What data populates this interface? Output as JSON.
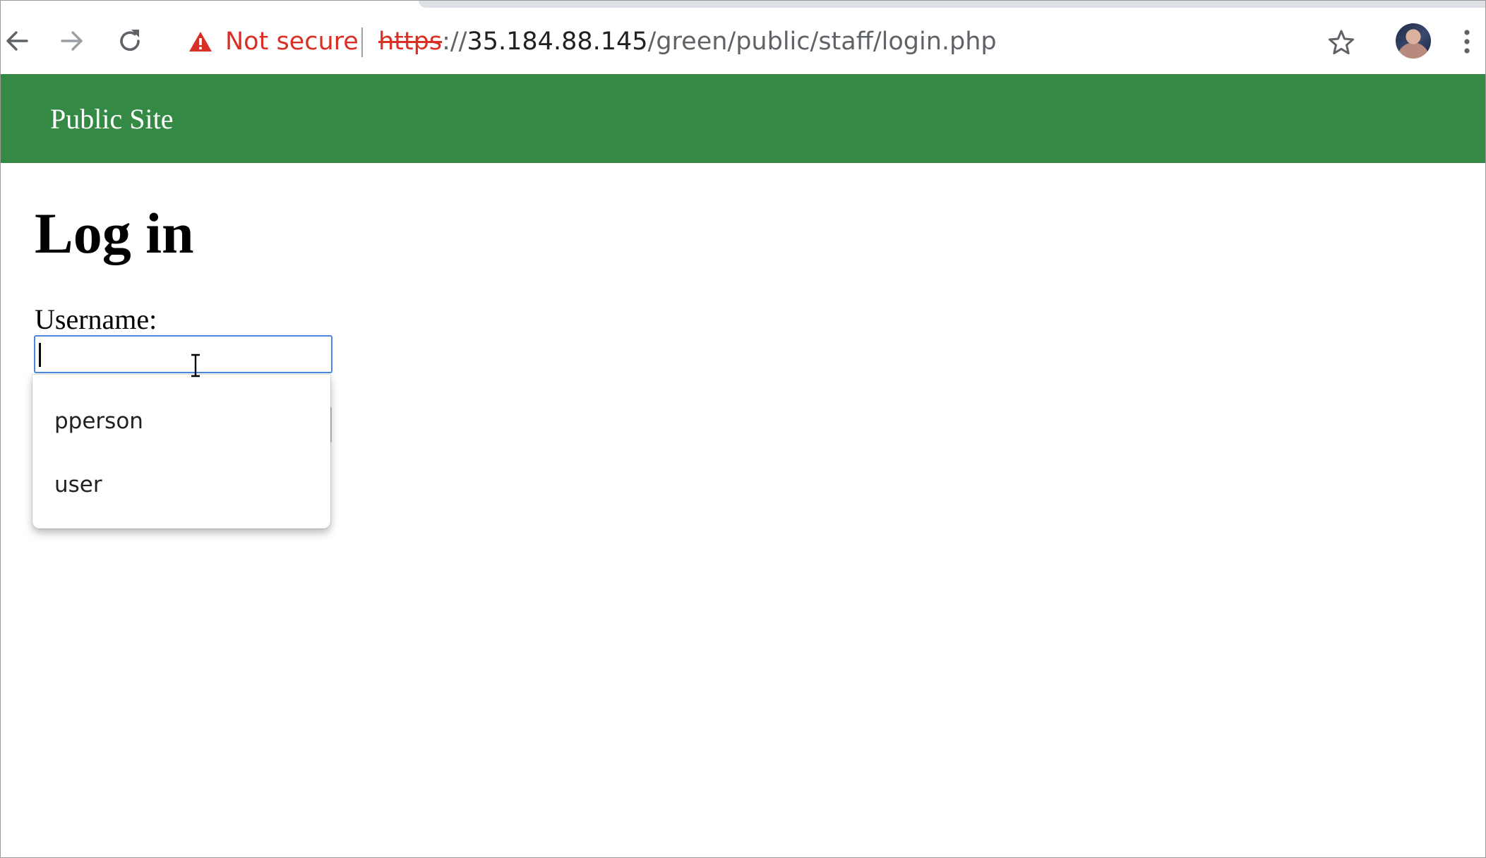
{
  "browser": {
    "security_label": "Not secure",
    "url_scheme": "https",
    "url_separator": "://",
    "url_host": "35.184.88.145",
    "url_path": "/green/public/staff/login.php",
    "icons": {
      "back": "back-arrow-icon",
      "forward": "forward-arrow-icon",
      "reload": "reload-icon",
      "warning": "warning-triangle-icon",
      "bookmark": "star-icon",
      "menu": "kebab-menu-icon"
    },
    "colors": {
      "warning": "#d93025",
      "toolbar_icon": "#5f6368"
    }
  },
  "nav": {
    "link_label": "Public Site",
    "background_color": "#348a45"
  },
  "main": {
    "title": "Log in",
    "username_label": "Username:",
    "username_value": "",
    "focus_color": "#4f86e6"
  },
  "autocomplete": {
    "suggestions": [
      "pperson",
      "user"
    ]
  }
}
